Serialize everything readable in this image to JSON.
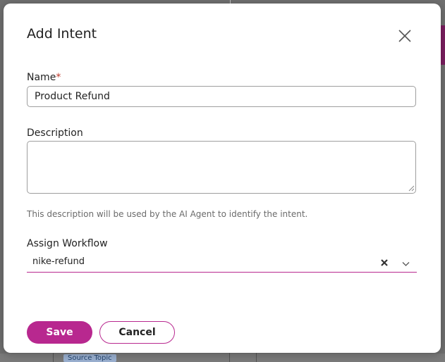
{
  "dialog": {
    "title": "Add Intent",
    "name_label": "Name",
    "required_marker": "*",
    "name_value": "Product Refund",
    "description_label": "Description",
    "description_value": "",
    "helper_text": "This description will be used by the AI Agent to identify the intent.",
    "workflow_label": "Assign Workflow",
    "workflow_value": "nike-refund",
    "save_label": "Save",
    "cancel_label": "Cancel"
  },
  "background": {
    "chip_label": "Source Topic"
  },
  "colors": {
    "accent": "#b8288f",
    "required": "#c0392b",
    "overlay": "#6f6f6f"
  },
  "icons": {
    "close": "close-icon",
    "clear": "clear-icon",
    "dropdown": "chevron-down-icon",
    "resize": "resize-grip-icon"
  }
}
